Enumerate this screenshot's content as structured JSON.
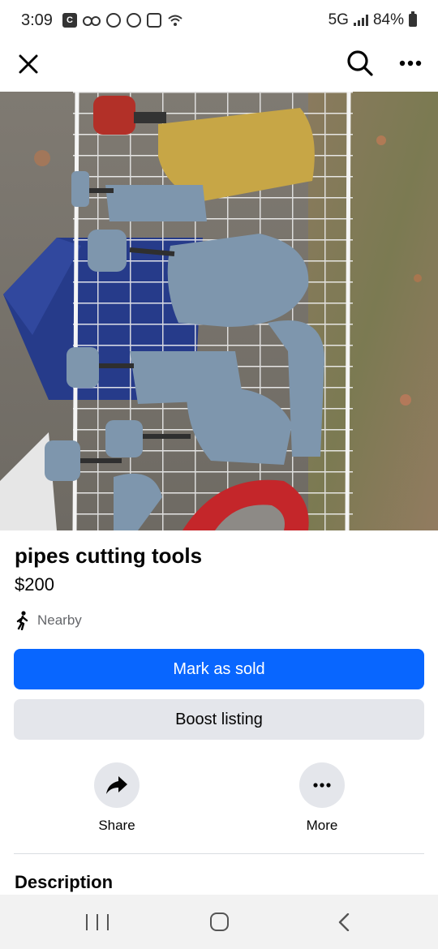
{
  "status_bar": {
    "time": "3:09",
    "app_icon_letter": "C",
    "network": "5G",
    "battery": "84%"
  },
  "listing": {
    "title": "pipes cutting tools",
    "price": "$200",
    "location": "Nearby"
  },
  "buttons": {
    "mark_as_sold": "Mark as sold",
    "boost_listing": "Boost listing"
  },
  "actions": [
    {
      "label": "Share",
      "icon": "share-arrow-icon"
    },
    {
      "label": "More",
      "icon": "more-dots-icon"
    }
  ],
  "sections": {
    "description": "Description"
  },
  "colors": {
    "primary": "#0866ff",
    "secondary_bg": "#e4e6eb",
    "muted_text": "#65676b"
  }
}
